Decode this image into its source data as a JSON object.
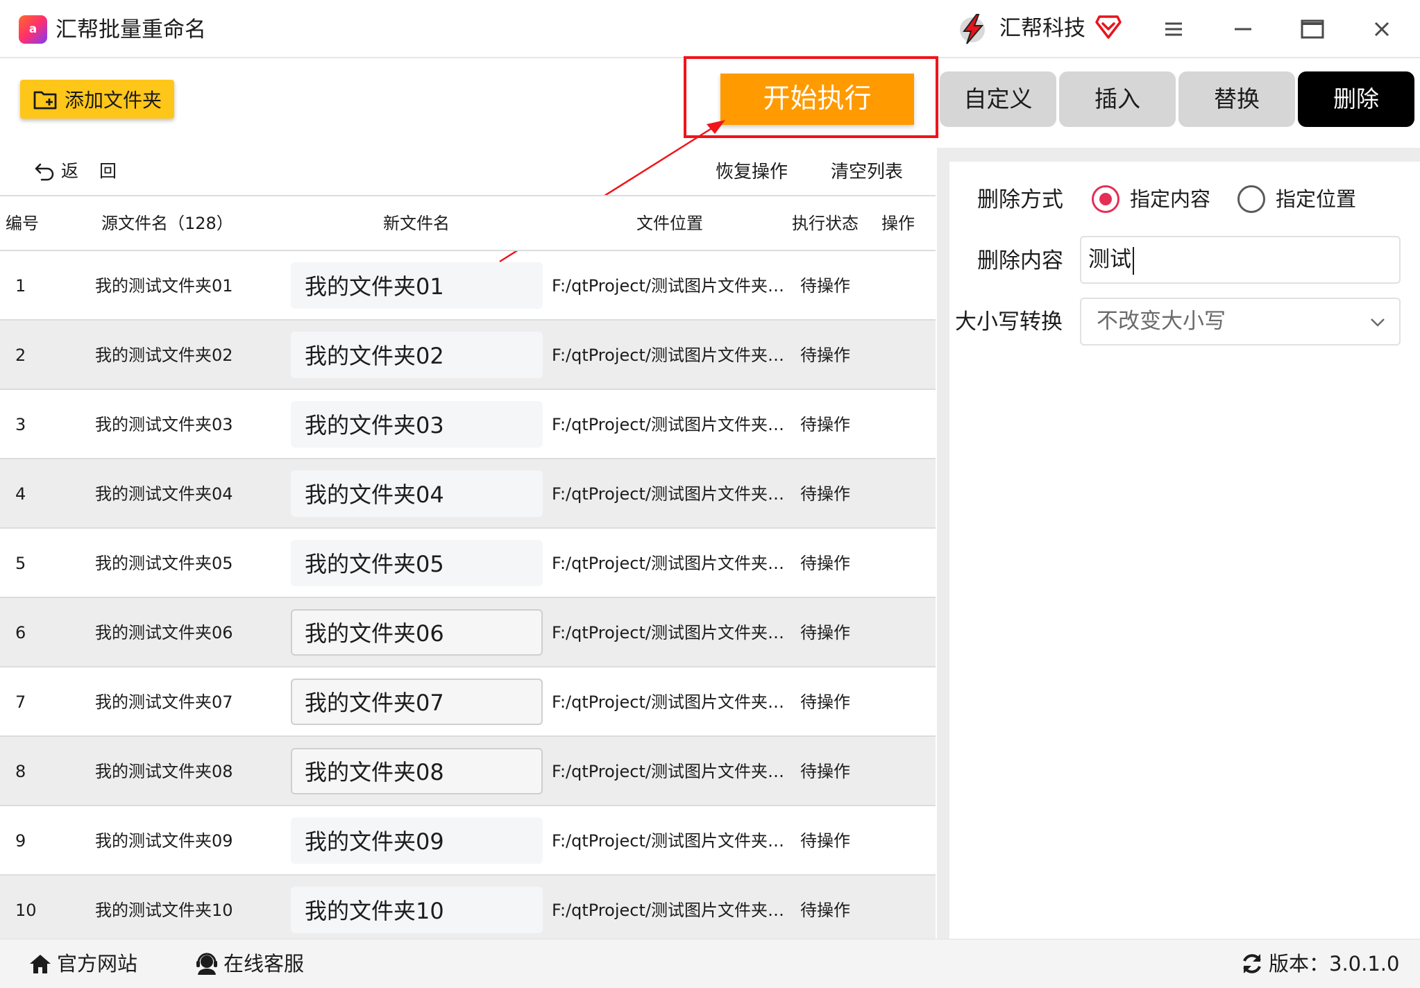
{
  "window": {
    "app_logo_text": "a",
    "title": "汇帮批量重命名",
    "brand_name": "汇帮科技"
  },
  "toolbar": {
    "add_folder_label": "添加文件夹",
    "start_label": "开始执行"
  },
  "tabs": [
    {
      "label": "自定义",
      "active": false
    },
    {
      "label": "插入",
      "active": false
    },
    {
      "label": "替换",
      "active": false
    },
    {
      "label": "删除",
      "active": true
    }
  ],
  "subbar": {
    "back_label": "返回",
    "restore_label": "恢复操作",
    "clear_label": "清空列表"
  },
  "table": {
    "headers": {
      "num": "编号",
      "src": "源文件名（128）",
      "new": "新文件名",
      "path": "文件位置",
      "status": "执行状态",
      "op": "操作"
    },
    "rows": [
      {
        "num": "1",
        "src": "我的测试文件夹01",
        "new": "我的文件夹01",
        "path": "F:/qtProject/测试图片文件夹/...",
        "status": "待操作"
      },
      {
        "num": "2",
        "src": "我的测试文件夹02",
        "new": "我的文件夹02",
        "path": "F:/qtProject/测试图片文件夹/...",
        "status": "待操作"
      },
      {
        "num": "3",
        "src": "我的测试文件夹03",
        "new": "我的文件夹03",
        "path": "F:/qtProject/测试图片文件夹/...",
        "status": "待操作"
      },
      {
        "num": "4",
        "src": "我的测试文件夹04",
        "new": "我的文件夹04",
        "path": "F:/qtProject/测试图片文件夹/...",
        "status": "待操作"
      },
      {
        "num": "5",
        "src": "我的测试文件夹05",
        "new": "我的文件夹05",
        "path": "F:/qtProject/测试图片文件夹/...",
        "status": "待操作"
      },
      {
        "num": "6",
        "src": "我的测试文件夹06",
        "new": "我的文件夹06",
        "path": "F:/qtProject/测试图片文件夹/...",
        "status": "待操作"
      },
      {
        "num": "7",
        "src": "我的测试文件夹07",
        "new": "我的文件夹07",
        "path": "F:/qtProject/测试图片文件夹/...",
        "status": "待操作"
      },
      {
        "num": "8",
        "src": "我的测试文件夹08",
        "new": "我的文件夹08",
        "path": "F:/qtProject/测试图片文件夹/...",
        "status": "待操作"
      },
      {
        "num": "9",
        "src": "我的测试文件夹09",
        "new": "我的文件夹09",
        "path": "F:/qtProject/测试图片文件夹/...",
        "status": "待操作"
      },
      {
        "num": "10",
        "src": "我的测试文件夹10",
        "new": "我的文件夹10",
        "path": "F:/qtProject/测试图片文件夹/...",
        "status": "待操作"
      }
    ]
  },
  "settings": {
    "mode_label": "删除方式",
    "mode_options": [
      {
        "label": "指定内容",
        "selected": true
      },
      {
        "label": "指定位置",
        "selected": false
      }
    ],
    "content_label": "删除内容",
    "content_value": "测试",
    "case_label": "大小写转换",
    "case_value": "不改变大小写"
  },
  "footer": {
    "website_label": "官方网站",
    "support_label": "在线客服",
    "version_text": "版本：3.0.1.0"
  },
  "colors": {
    "accent_orange": "#ff9a00",
    "add_button_yellow": "#ffc61a",
    "highlight_red": "#f0141b",
    "radio_pink": "#e52e55",
    "active_tab": "#000000"
  }
}
